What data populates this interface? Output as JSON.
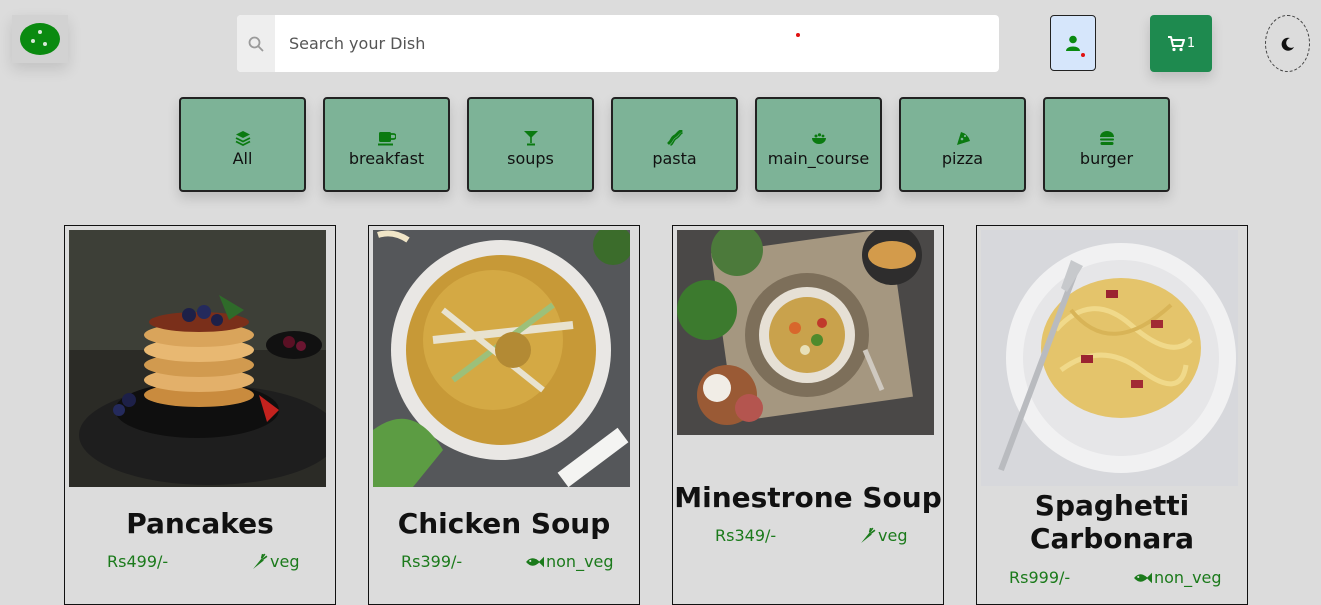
{
  "header": {
    "search": {
      "placeholder": "Search your Dish",
      "value": ""
    },
    "cart": {
      "count": "1"
    },
    "colors": {
      "accent": "#1e8a4f",
      "category_bg": "#7db397",
      "price": "#1b7a1b"
    }
  },
  "categories": [
    {
      "label": "All",
      "icon": "layers-icon"
    },
    {
      "label": "breakfast",
      "icon": "coffee-mug-icon"
    },
    {
      "label": "soups",
      "icon": "cocktail-glass-icon"
    },
    {
      "label": "pasta",
      "icon": "bacon-icon"
    },
    {
      "label": "main_course",
      "icon": "bowl-icon"
    },
    {
      "label": "pizza",
      "icon": "pizza-slice-icon"
    },
    {
      "label": "burger",
      "icon": "burger-icon"
    }
  ],
  "dishes": [
    {
      "name": "Pancakes",
      "price": "Rs499/-",
      "diet": "veg",
      "diet_icon": "carrot-icon"
    },
    {
      "name": "Chicken Soup",
      "price": "Rs399/-",
      "diet": "non_veg",
      "diet_icon": "fish-icon"
    },
    {
      "name": "Minestrone Soup",
      "price": "Rs349/-",
      "diet": "veg",
      "diet_icon": "carrot-icon"
    },
    {
      "name": "Spaghetti Carbonara",
      "price": "Rs999/-",
      "diet": "non_veg",
      "diet_icon": "fish-icon"
    }
  ]
}
